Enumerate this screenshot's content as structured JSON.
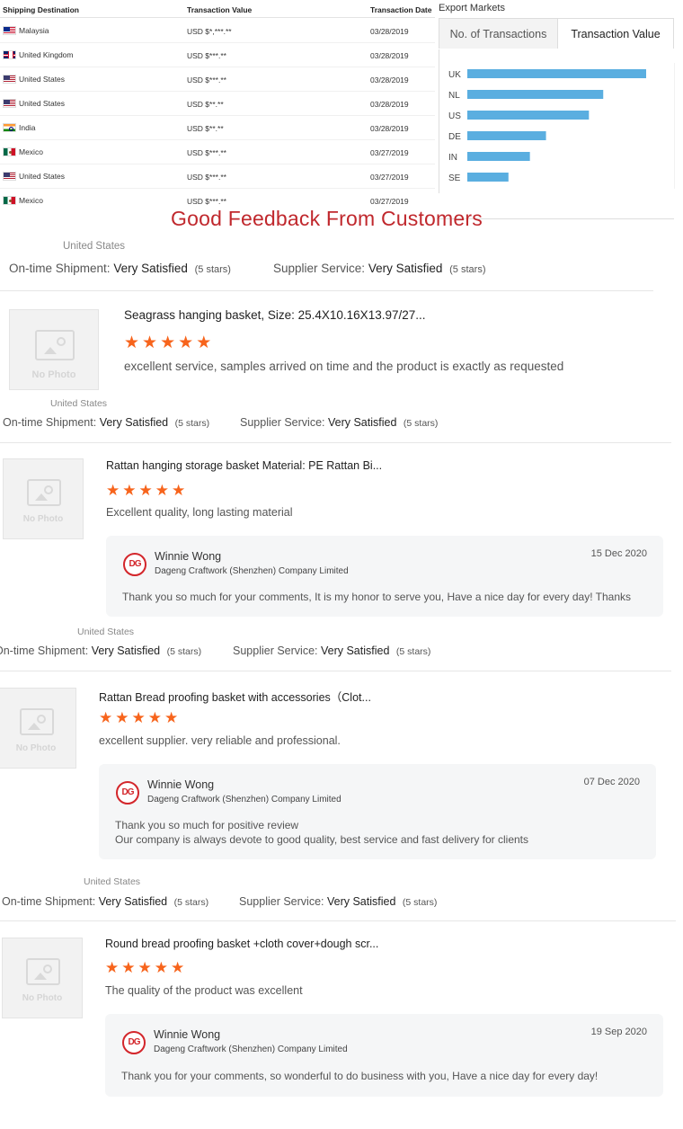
{
  "transactions": {
    "headers": {
      "destination": "Shipping Destination",
      "value": "Transaction Value",
      "date": "Transaction Date"
    },
    "rows": [
      {
        "flag": "malaysia-flag-icon",
        "country": "Malaysia",
        "value": "USD $*,***.**",
        "date": "03/28/2019"
      },
      {
        "flag": "uk-flag-icon",
        "country": "United Kingdom",
        "value": "USD $***.**",
        "date": "03/28/2019"
      },
      {
        "flag": "us-flag-icon",
        "country": "United States",
        "value": "USD $***.**",
        "date": "03/28/2019"
      },
      {
        "flag": "us-flag-icon",
        "country": "United States",
        "value": "USD $**.**",
        "date": "03/28/2019"
      },
      {
        "flag": "india-flag-icon",
        "country": "India",
        "value": "USD $**.**",
        "date": "03/28/2019"
      },
      {
        "flag": "mexico-flag-icon",
        "country": "Mexico",
        "value": "USD $***.**",
        "date": "03/27/2019"
      },
      {
        "flag": "us-flag-icon",
        "country": "United States",
        "value": "USD $***.**",
        "date": "03/27/2019"
      },
      {
        "flag": "mexico-flag-icon",
        "country": "Mexico",
        "value": "USD $***.**",
        "date": "03/27/2019"
      }
    ]
  },
  "export_markets": {
    "title": "Export Markets",
    "tabs": [
      "No. of Transactions",
      "Transaction Value"
    ],
    "active_tab": "Transaction Value"
  },
  "chart_data": {
    "type": "bar",
    "orientation": "horizontal",
    "categories": [
      "UK",
      "NL",
      "US",
      "DE",
      "IN",
      "SE"
    ],
    "values": [
      100,
      76,
      68,
      44,
      35,
      23
    ],
    "color": "#5aaee0",
    "grid": false
  },
  "heading": "Good Feedback From Customers",
  "top_rating": {
    "country": "United States",
    "shipment_label": "On-time Shipment:",
    "shipment_value": "Very Satisfied",
    "shipment_stars": "(5 stars)",
    "service_label": "Supplier Service:",
    "service_value": "Very Satisfied",
    "service_stars": "(5 stars)"
  },
  "reviews": [
    {
      "thumb_text": "No Photo",
      "title": "Seagrass hanging basket, Size: 25.4X10.16X13.97/27...",
      "stars": 5,
      "text": "excellent service, samples arrived on time and the product is exactly as requested",
      "rating": {
        "country": "United States",
        "shipment_label": "On-time Shipment:",
        "shipment_value": "Very Satisfied",
        "shipment_stars": "(5 stars)",
        "service_label": "Supplier Service:",
        "service_value": "Very Satisfied",
        "service_stars": "(5 stars)"
      }
    },
    {
      "thumb_text": "No Photo",
      "title": "Rattan hanging storage basket Material: PE Rattan Bi...",
      "stars": 5,
      "text": "Excellent quality, long lasting material",
      "reply": {
        "logo": "DG",
        "name": "Winnie Wong",
        "company": "Dageng Craftwork (Shenzhen) Company Limited",
        "date": "15 Dec 2020",
        "text": "Thank you so much for your comments, It is my honor to serve you, Have a nice day for every day! Thanks"
      },
      "rating": {
        "country": "United States",
        "shipment_label": "On-time Shipment:",
        "shipment_value": "Very Satisfied",
        "shipment_stars": "(5 stars)",
        "service_label": "Supplier Service:",
        "service_value": "Very Satisfied",
        "service_stars": "(5 stars)"
      }
    },
    {
      "thumb_text": "No Photo",
      "title": "Rattan Bread proofing basket with accessories（Clot...",
      "stars": 5,
      "text": "excellent supplier. very reliable and professional.",
      "reply": {
        "logo": "DG",
        "name": "Winnie Wong",
        "company": "Dageng Craftwork (Shenzhen) Company Limited",
        "date": "07 Dec 2020",
        "text": "Thank you so much for positive review",
        "text2": "Our company is always devote to good quality, best service and fast delivery for clients"
      },
      "rating": {
        "country": "United States",
        "shipment_label": "On-time Shipment:",
        "shipment_value": "Very Satisfied",
        "shipment_stars": "(5 stars)",
        "service_label": "Supplier Service:",
        "service_value": "Very Satisfied",
        "service_stars": "(5 stars)"
      }
    },
    {
      "thumb_text": "No Photo",
      "title": "Round bread proofing basket +cloth cover+dough scr...",
      "stars": 5,
      "text": "The quality of the product was excellent",
      "reply": {
        "logo": "DG",
        "name": "Winnie Wong",
        "company": "Dageng Craftwork (Shenzhen) Company Limited",
        "date": "19 Sep 2020",
        "text": "Thank you for your comments, so wonderful to do business with you, Have a nice day for every day!"
      }
    }
  ]
}
